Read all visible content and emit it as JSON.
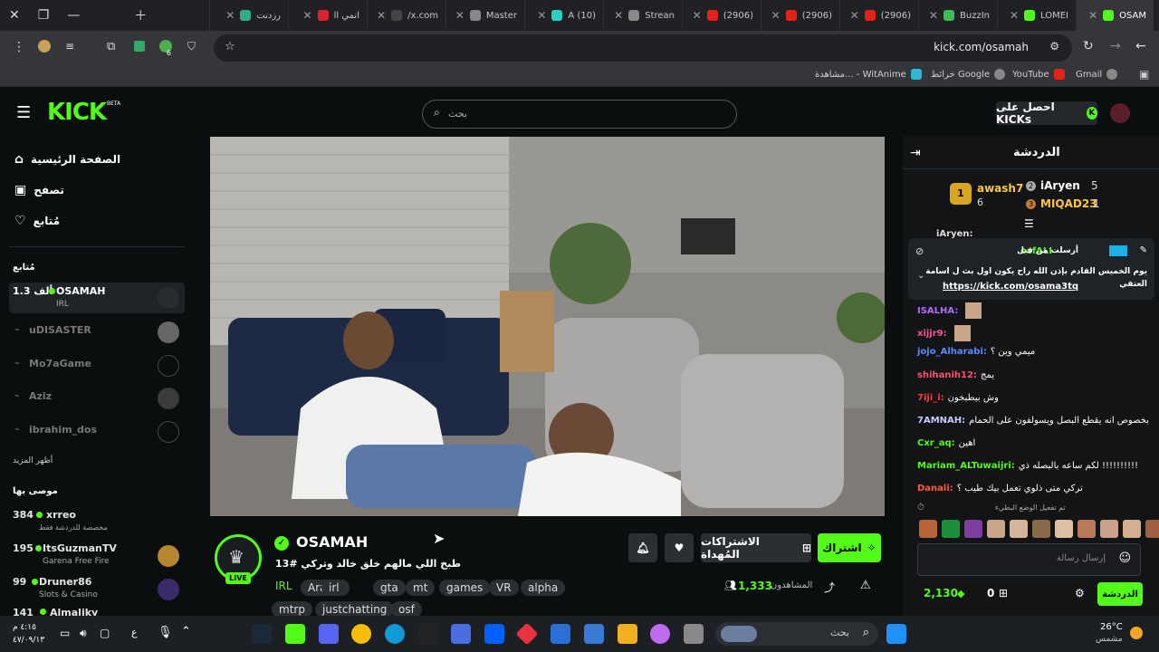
{
  "browser": {
    "tabs": [
      {
        "label": "OSAM",
        "active": true
      },
      {
        "label": "LOMEI"
      },
      {
        "label": "BuzzIn"
      },
      {
        "label": "(2906)"
      },
      {
        "label": "(2906)"
      },
      {
        "label": "(2906)"
      },
      {
        "label": "Strean"
      },
      {
        "label": "(10) A"
      },
      {
        "label": "Master"
      },
      {
        "label": "x.com/"
      },
      {
        "label": "انمي ll"
      },
      {
        "label": "رزدنت"
      }
    ],
    "url": "kick.com/osamah",
    "bookmarks": [
      {
        "label": "Gmail"
      },
      {
        "label": "YouTube"
      },
      {
        "label": "خرائط Google"
      },
      {
        "label": "مشاهدة... - WitAnime"
      }
    ],
    "extension_badge": "6"
  },
  "kick": {
    "logo_text": "KICK",
    "beta": "BETA",
    "search_placeholder": "بحث",
    "get_kicks": "احصل على KICKs",
    "nav": {
      "home": "الصفحة الرئيسية",
      "browse": "تصفح",
      "following": "مُتابع"
    },
    "following_title": "مُتابع",
    "following_channels": [
      {
        "name": "OSAMAH",
        "meta": "IRL",
        "viewers": "1.3 ألف",
        "live": true
      },
      {
        "name": "uDISASTER"
      },
      {
        "name": "Mo7aGame"
      },
      {
        "name": "Aziz"
      },
      {
        "name": "ibrahim_dos"
      }
    ],
    "show_more": "أظهر المزيد",
    "recommended_title": "موصى بها",
    "recommended": [
      {
        "name": "xrreo",
        "meta": "مخصصة للدردشة فقط",
        "viewers": "384"
      },
      {
        "name": "ItsGuzmanTV",
        "meta": "Garena Free Fire",
        "viewers": "195"
      },
      {
        "name": "Druner86",
        "meta": "Slots & Casino",
        "viewers": "99"
      },
      {
        "name": "Almaliky",
        "meta": "",
        "viewers": "141"
      }
    ]
  },
  "stream": {
    "channel": "OSAMAH",
    "title": "طبخ اللي مالهم خلق خالد وتركي #13",
    "live_label": "LIVE",
    "category": "IRL",
    "tags": [
      "Arabic",
      "irl",
      "gta",
      "mt",
      "games",
      "VR",
      "alpha",
      "mtrp",
      "justchatting",
      "osf"
    ],
    "viewers_label": "المشاهدون",
    "viewers": "1,333",
    "subscribe": "اشتراك",
    "gift_subs": "الاشتراكات المُهداة"
  },
  "chat": {
    "title": "الدردشة",
    "leaderboard": [
      {
        "rank": "1",
        "name": "awash7",
        "count": "6"
      },
      {
        "rank": "2",
        "name": "iAryen",
        "count": "5"
      },
      {
        "rank": "3",
        "name": "MIQAD23",
        "count": "1"
      }
    ],
    "pinned": {
      "by_label": "أرسلت من قبل",
      "by_user": "osfALI",
      "text": "يوم الخميس القادم بإذن الله راح يكون اول بث ل اسامة العتقي",
      "link": "https://kick.com/osama3tq"
    },
    "hidden_user_top": "iAryen:",
    "messages": [
      {
        "user": "ISALHA:",
        "text": "",
        "color": "#b36bff"
      },
      {
        "user": "xijjr9:",
        "text": "",
        "color": "#ff4f9b"
      },
      {
        "user": "jojo_Alharabi:",
        "text": "ميمي وين ؟",
        "color": "#5b8cff"
      },
      {
        "user": "shihanih12:",
        "text": "يمج",
        "color": "#ff4f6d"
      },
      {
        "user": "7iji_i:",
        "text": "وش بيطبخون",
        "color": "#ff3b3b"
      },
      {
        "user": "7AMNAH:",
        "text": "بخصوص انه يقطع البصل ويسولفون على الحمام",
        "color": "#c9c9ff"
      },
      {
        "user": "Cxr_aq:",
        "text": "اهين",
        "color": "#53fc18"
      },
      {
        "user": "Mariam_ALTuwaijri:",
        "text": "لكم ساعه بالبصله ذي !!!!!!!!!!",
        "color": "#53fc18"
      },
      {
        "user": "Danali:",
        "text": "تركي متى ذلوي تعمل بيك طيب ؟",
        "color": "#ff5a3b"
      }
    ],
    "slow_mode": "تم تفعيل الوضع البطيء",
    "input_placeholder": "إرسال رسالة",
    "points": "2,130",
    "gifts": "0",
    "send": "الدردشة"
  },
  "taskbar": {
    "time": "٤:١٥ م",
    "date": "٤٧/٠٩/١٣",
    "search_placeholder": "بحث",
    "lang": "ع",
    "weather_temp": "26°C",
    "weather_desc": "مشمس"
  },
  "colors": {
    "kick_green": "#53fc18",
    "bg": "#0b0e0f"
  }
}
